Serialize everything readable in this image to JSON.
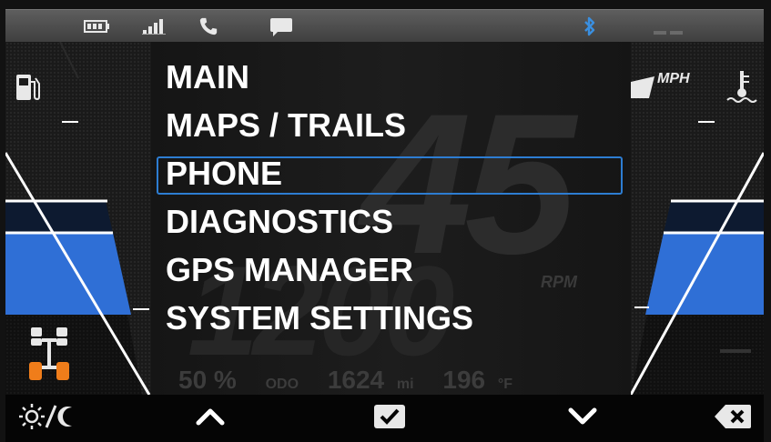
{
  "status_bar": {
    "icons": [
      "battery-icon",
      "signal-icon",
      "phone-icon",
      "message-icon",
      "bluetooth-icon"
    ],
    "bluetooth_color": "#3a8fe0"
  },
  "gauge": {
    "speed": "45",
    "speed_unit": "MPH",
    "rpm": "1200",
    "rpm_label": "RPM",
    "fuel_percent": "50 %",
    "odo_label": "ODO",
    "odo_value": "1624",
    "odo_unit": "mi",
    "temp_value": "196",
    "temp_unit": "°F"
  },
  "menu": {
    "items": [
      {
        "label": "MAIN"
      },
      {
        "label": "MAPS / TRAILS"
      },
      {
        "label": "PHONE"
      },
      {
        "label": "DIAGNOSTICS"
      },
      {
        "label": "GPS MANAGER"
      },
      {
        "label": "SYSTEM SETTINGS"
      }
    ],
    "selected_label": "PHONE"
  },
  "bottom_bar": {
    "buttons": [
      "day-night-toggle",
      "up-arrow",
      "select-check",
      "down-arrow",
      "back-delete"
    ]
  },
  "colors": {
    "accent_blue": "#2f6fd6",
    "selection_border": "#2d7dd2",
    "drive_indicator": "#f07d1a"
  }
}
